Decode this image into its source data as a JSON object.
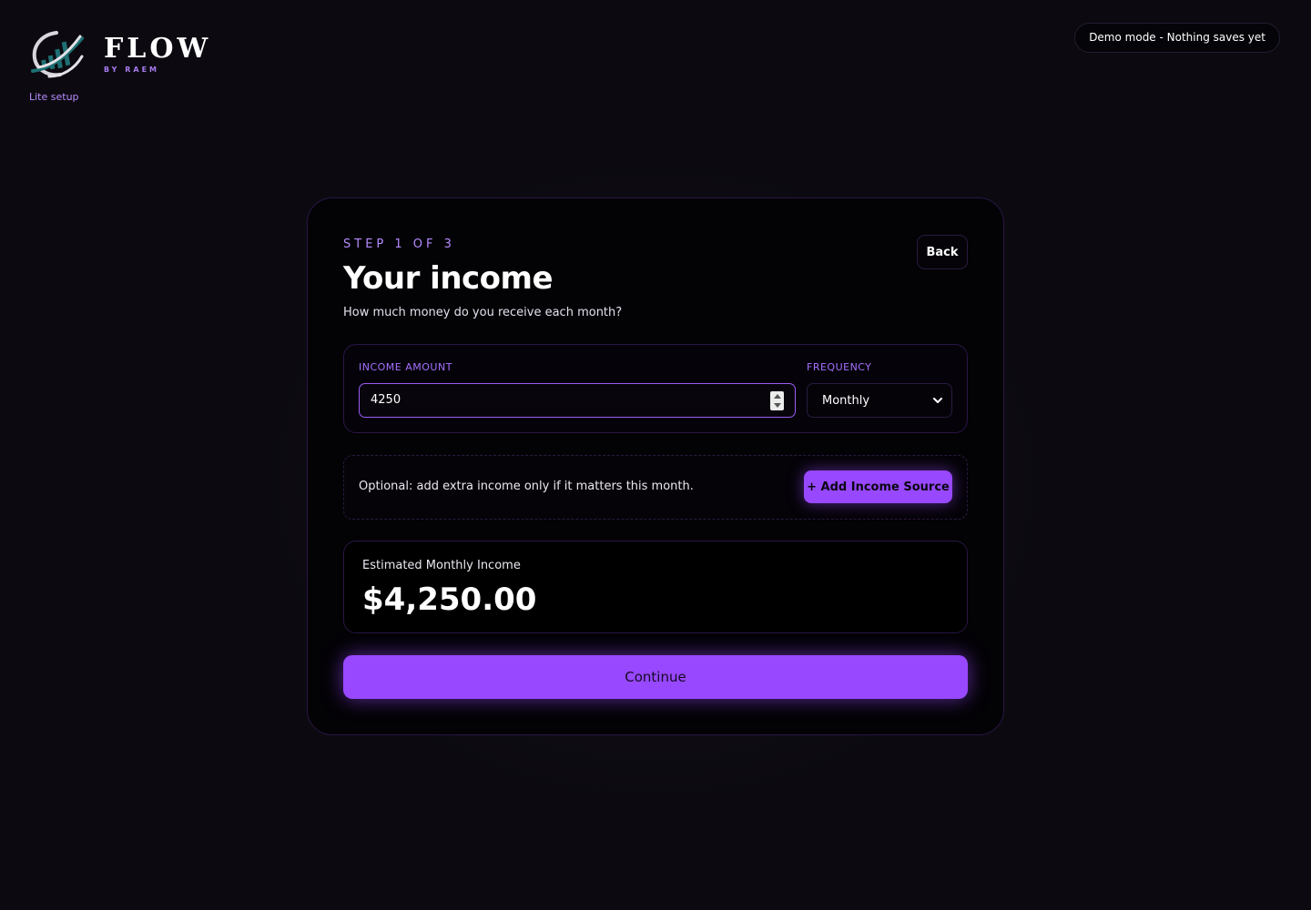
{
  "brand": {
    "title": "FLOW",
    "subtitle": "BY RAEM",
    "setup_link": "Lite setup",
    "logo_icon": "flow-logo-icon"
  },
  "demo_badge": "Demo mode - Nothing saves yet",
  "card": {
    "step": "STEP 1 OF 3",
    "back_label": "Back",
    "title": "Your income",
    "subtitle": "How much money do you receive each month?"
  },
  "income": {
    "amount_label": "INCOME AMOUNT",
    "amount_value": "4250",
    "frequency_label": "FREQUENCY",
    "frequency_value": "Monthly"
  },
  "optional": {
    "text": "Optional: add extra income only if it matters this month.",
    "add_label": "+ Add Income Source"
  },
  "estimate": {
    "label": "Estimated Monthly Income",
    "value": "$4,250.00"
  },
  "continue_label": "Continue",
  "colors": {
    "accent": "#9848ff",
    "accent_text": "#b68cff",
    "background": "#0c0a10",
    "card": "#030205",
    "logo_teal": "#1f6f72"
  }
}
